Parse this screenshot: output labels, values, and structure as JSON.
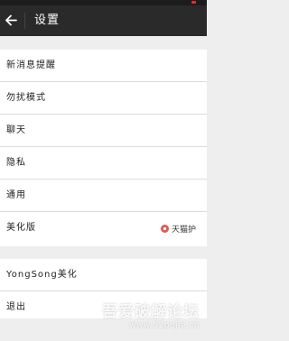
{
  "header": {
    "title": "设置",
    "back_icon": "arrow-left-icon"
  },
  "settings_group": [
    {
      "label": "新消息提醒"
    },
    {
      "label": "勿扰模式"
    },
    {
      "label": "聊天"
    },
    {
      "label": "隐私"
    },
    {
      "label": "通用"
    },
    {
      "label": "美化版",
      "badge": "天猫护",
      "badge_icon": "lock-icon",
      "badge_color": "#e05b5b"
    }
  ],
  "account_group": [
    {
      "label": "YongSong美化"
    },
    {
      "label": "退出"
    }
  ],
  "watermark": {
    "main": "吾爱破解论坛",
    "sub": "www.52pojie.cn"
  }
}
